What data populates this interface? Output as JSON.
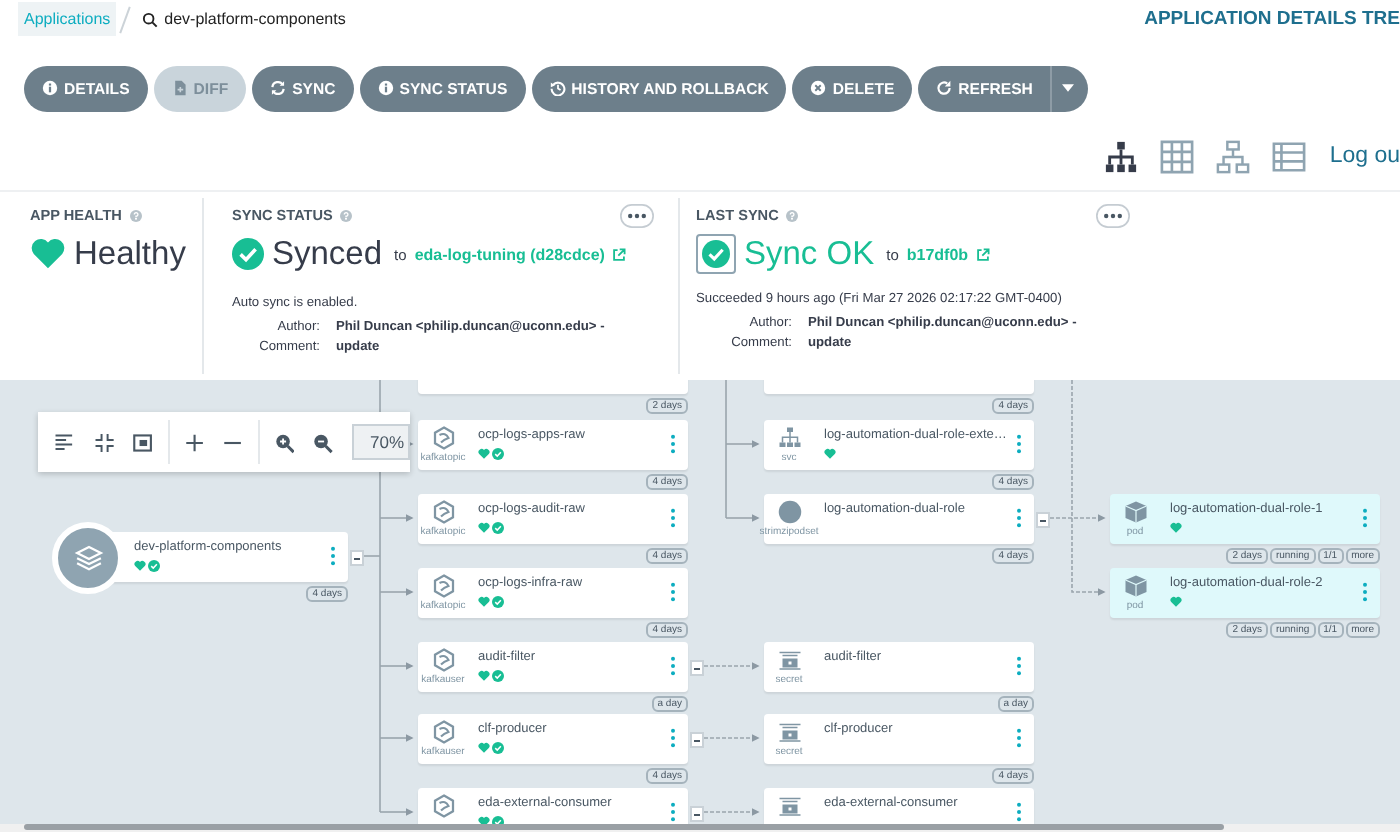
{
  "breadcrumb": {
    "root": "Applications",
    "current": "dev-platform-components"
  },
  "page_title": "APPLICATION DETAILS TRE",
  "actions": [
    {
      "label": "DETAILS",
      "kind": "info",
      "disabled": false
    },
    {
      "label": "DIFF",
      "kind": "file",
      "disabled": true
    },
    {
      "label": "SYNC",
      "kind": "sync",
      "disabled": false
    },
    {
      "label": "SYNC STATUS",
      "kind": "info",
      "disabled": false
    },
    {
      "label": "HISTORY AND ROLLBACK",
      "kind": "history",
      "disabled": false
    },
    {
      "label": "DELETE",
      "kind": "delete",
      "disabled": false
    },
    {
      "label": "REFRESH",
      "kind": "refresh",
      "disabled": false,
      "dropdown": true
    }
  ],
  "views": [
    {
      "kind": "tree",
      "selected": true
    },
    {
      "kind": "grid",
      "selected": false
    },
    {
      "kind": "network",
      "selected": false
    },
    {
      "kind": "list",
      "selected": false
    }
  ],
  "logout": "Log ou",
  "app_health": {
    "title": "APP HEALTH",
    "status": "Healthy"
  },
  "sync_status": {
    "title": "SYNC STATUS",
    "status": "Synced",
    "to": "to",
    "revision": "eda-log-tuning (d28cdce)",
    "note": "Auto sync is enabled.",
    "details": [
      {
        "label": "Author:",
        "value": "Phil Duncan <philip.duncan@uconn.edu> -"
      },
      {
        "label": "Comment:",
        "value": "update"
      }
    ]
  },
  "last_sync": {
    "title": "LAST SYNC",
    "status": "Sync OK",
    "to": "to",
    "revision": "b17df0b",
    "note": "Succeeded 9 hours ago (Fri Mar 27 2026 02:17:22 GMT-0400)",
    "details": [
      {
        "label": "Author:",
        "value": "Phil Duncan <philip.duncan@uconn.edu> -"
      },
      {
        "label": "Comment:",
        "value": "update"
      }
    ]
  },
  "graph_toolbar": {
    "tools": [
      {
        "kind": "align"
      },
      {
        "kind": "compact"
      },
      {
        "kind": "fit"
      },
      {
        "kind": "plus"
      },
      {
        "kind": "minus"
      },
      {
        "kind": "zoom-in"
      },
      {
        "kind": "zoom-out"
      }
    ],
    "zoom": "70%"
  },
  "nodes": [
    {
      "kind": "app",
      "name": "dev-platform-components",
      "health": true,
      "synced": true,
      "badges": [
        "4 days"
      ],
      "collapsible": true
    },
    {
      "badges": [
        "2 days"
      ]
    },
    {
      "kind": "kafkatopic",
      "kind_label": "kafkatopic",
      "name": "ocp-logs-apps-raw",
      "health": true,
      "synced": true,
      "badges": [
        "4 days"
      ]
    },
    {
      "kind": "kafkatopic",
      "kind_label": "kafkatopic",
      "name": "ocp-logs-audit-raw",
      "health": true,
      "synced": true,
      "badges": [
        "4 days"
      ]
    },
    {
      "kind": "kafkatopic",
      "kind_label": "kafkatopic",
      "name": "ocp-logs-infra-raw",
      "health": true,
      "synced": true,
      "badges": [
        "4 days"
      ]
    },
    {
      "kind": "kafkauser",
      "kind_label": "kafkauser",
      "name": "audit-filter",
      "health": true,
      "synced": true,
      "badges": [
        "a day"
      ],
      "collapsible": true
    },
    {
      "kind": "kafkauser",
      "kind_label": "kafkauser",
      "name": "clf-producer",
      "health": true,
      "synced": true,
      "badges": [
        "4 days"
      ],
      "collapsible": true
    },
    {
      "kind": "kafkauser",
      "name": "eda-external-consumer",
      "health": true,
      "synced": true,
      "collapsible": true
    },
    {
      "badges": [
        "4 days"
      ]
    },
    {
      "kind": "svc",
      "kind_label": "svc",
      "name": "log-automation-dual-role-exte…",
      "health": true,
      "synced": false,
      "badges": [
        "4 days"
      ]
    },
    {
      "kind": "strimzipodset",
      "kind_label": "strimzipodset",
      "name": "log-automation-dual-role",
      "health": false,
      "synced": false,
      "badges": [
        "4 days"
      ],
      "collapsible": true
    },
    {
      "kind": "secret",
      "kind_label": "secret",
      "name": "audit-filter",
      "health": false,
      "synced": false,
      "badges": [
        "a day"
      ]
    },
    {
      "kind": "secret",
      "kind_label": "secret",
      "name": "clf-producer",
      "health": false,
      "synced": false,
      "badges": [
        "4 days"
      ]
    },
    {
      "kind": "secret",
      "name": "eda-external-consumer",
      "health": false,
      "synced": false
    },
    {
      "kind": "pod",
      "kind_label": "pod",
      "name": "log-automation-dual-role-1",
      "health": true,
      "synced": false,
      "badges": [
        "2 days",
        "running",
        "1/1",
        "more"
      ]
    },
    {
      "kind": "pod",
      "kind_label": "pod",
      "name": "log-automation-dual-role-2",
      "health": true,
      "synced": false,
      "badges": [
        "2 days",
        "running",
        "1/1",
        "more"
      ]
    }
  ]
}
